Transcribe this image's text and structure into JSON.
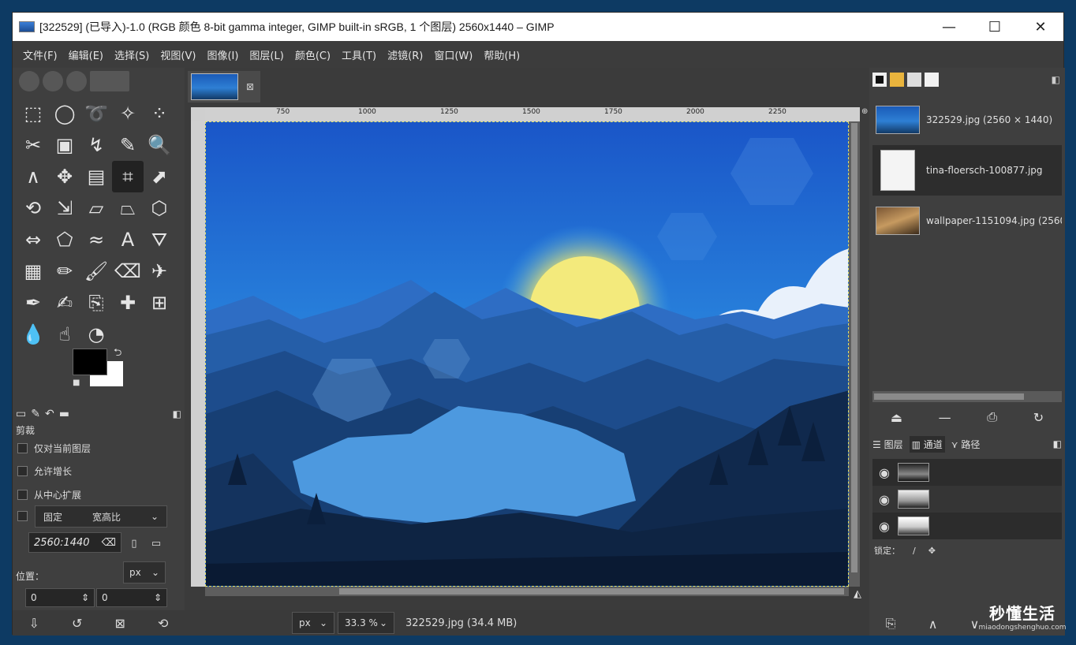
{
  "window": {
    "title": "[322529] (已导入)-1.0 (RGB 颜色 8-bit gamma integer, GIMP built-in sRGB, 1 个图层) 2560x1440 – GIMP",
    "controls": {
      "minimize": "—",
      "maximize": "☐",
      "close": "✕"
    }
  },
  "menu": [
    "文件(F)",
    "编辑(E)",
    "选择(S)",
    "视图(V)",
    "图像(I)",
    "图层(L)",
    "颜色(C)",
    "工具(T)",
    "滤镜(R)",
    "窗口(W)",
    "帮助(H)"
  ],
  "toolbox": {
    "tools": [
      {
        "icon": "rect-select-icon",
        "glyph": "⬚"
      },
      {
        "icon": "ellipse-select-icon",
        "glyph": "◯"
      },
      {
        "icon": "free-select-icon",
        "glyph": "➰"
      },
      {
        "icon": "fuzzy-select-icon",
        "glyph": "✧"
      },
      {
        "icon": "color-select-icon",
        "glyph": "⁘"
      },
      {
        "icon": "scissors-icon",
        "glyph": "✂"
      },
      {
        "icon": "foreground-select-icon",
        "glyph": "▣"
      },
      {
        "icon": "paths-icon",
        "glyph": "↯"
      },
      {
        "icon": "color-picker-icon",
        "glyph": "✎"
      },
      {
        "icon": "zoom-icon",
        "glyph": "🔍"
      },
      {
        "icon": "measure-icon",
        "glyph": "∧"
      },
      {
        "icon": "move-icon",
        "glyph": "✥"
      },
      {
        "icon": "align-icon",
        "glyph": "▤"
      },
      {
        "icon": "crop-icon",
        "glyph": "⌗"
      },
      {
        "icon": "unified-transform-icon",
        "glyph": "⬈"
      },
      {
        "icon": "rotate-icon",
        "glyph": "⟲"
      },
      {
        "icon": "scale-icon",
        "glyph": "⇲"
      },
      {
        "icon": "shear-icon",
        "glyph": "▱"
      },
      {
        "icon": "perspective-icon",
        "glyph": "⏢"
      },
      {
        "icon": "3d-transform-icon",
        "glyph": "⬡"
      },
      {
        "icon": "flip-icon",
        "glyph": "⇔"
      },
      {
        "icon": "cage-icon",
        "glyph": "⬠"
      },
      {
        "icon": "warp-icon",
        "glyph": "≈"
      },
      {
        "icon": "text-icon",
        "glyph": "A"
      },
      {
        "icon": "bucket-fill-icon",
        "glyph": "⛛"
      },
      {
        "icon": "gradient-icon",
        "glyph": "▦"
      },
      {
        "icon": "pencil-icon",
        "glyph": "✏"
      },
      {
        "icon": "paintbrush-icon",
        "glyph": "🖌"
      },
      {
        "icon": "eraser-icon",
        "glyph": "⌫"
      },
      {
        "icon": "airbrush-icon",
        "glyph": "✈"
      },
      {
        "icon": "ink-icon",
        "glyph": "✒"
      },
      {
        "icon": "mypaint-brush-icon",
        "glyph": "✍"
      },
      {
        "icon": "clone-icon",
        "glyph": "⎘"
      },
      {
        "icon": "heal-icon",
        "glyph": "✚"
      },
      {
        "icon": "perspective-clone-icon",
        "glyph": "⊞"
      },
      {
        "icon": "blur-icon",
        "glyph": "💧"
      },
      {
        "icon": "smudge-icon",
        "glyph": "☝"
      },
      {
        "icon": "dodge-burn-icon",
        "glyph": "◔"
      }
    ],
    "active_tool_index": 13,
    "options": {
      "tool_name": "剪裁",
      "current_layer_only": "仅对当前图层",
      "allow_growing": "允许增长",
      "expand_from_center": "从中心扩展",
      "fixed_label": "固定",
      "fixed_mode": "宽高比",
      "ratio_value": "2560:1440",
      "position_label": "位置：",
      "unit": "px",
      "pos_x": "0",
      "pos_y": "0"
    }
  },
  "canvas": {
    "ruler_marks": [
      "750",
      "1000",
      "1250",
      "1500",
      "1750",
      "2000",
      "2250"
    ],
    "status_unit": "px",
    "zoom": "33.3 %",
    "status_text": "322529.jpg (34.4 MB)"
  },
  "images_panel": {
    "items": [
      {
        "name": "322529.jpg (2560 × 1440)",
        "thumb": "blue"
      },
      {
        "name": "tina-floersch-100877.jpg",
        "thumb": "white"
      },
      {
        "name": "wallpaper-1151094.jpg (2560",
        "thumb": "brown"
      }
    ]
  },
  "layers_panel": {
    "tabs": [
      "图层",
      "通道",
      "路径"
    ],
    "lock_label": "锁定："
  },
  "watermark": {
    "big": "秒懂生活",
    "small": "miaodongshenghuo.com"
  },
  "colors": {
    "accent_sky": "#1d5fc6",
    "sun": "#f2e77a",
    "foreground": "#000000",
    "background": "#ffffff"
  }
}
